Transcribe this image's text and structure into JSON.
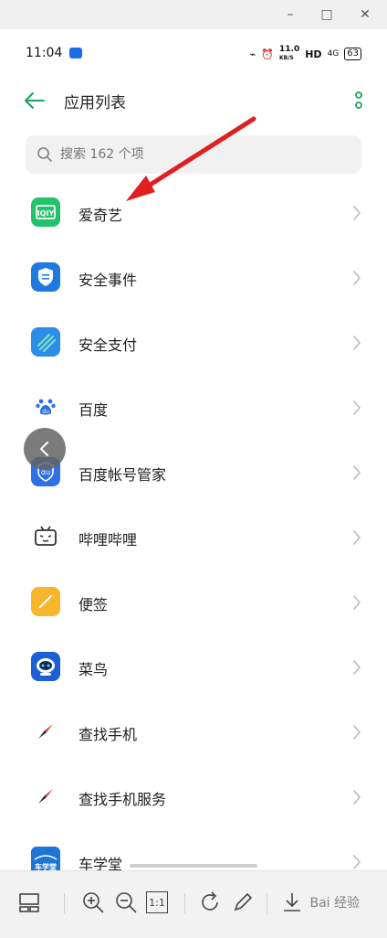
{
  "window": {
    "minimize": "–",
    "maximize": "□",
    "close": "✕"
  },
  "status": {
    "time": "11:04",
    "speed": "11.0",
    "speed_unit": "KB/S",
    "hd": "HD",
    "net": "4G",
    "battery": "63"
  },
  "header": {
    "title": "应用列表"
  },
  "search": {
    "placeholder": "搜索 162 个项"
  },
  "apps": [
    {
      "name": "爱奇艺",
      "icon": "iqiyi-icon",
      "color": "#22c36a"
    },
    {
      "name": "安全事件",
      "icon": "shield-icon",
      "color": "#1f7ae0"
    },
    {
      "name": "安全支付",
      "icon": "secure-pay-icon",
      "color": "#2b8de6"
    },
    {
      "name": "百度",
      "icon": "baidu-paw-icon",
      "color": "#2f6fe8"
    },
    {
      "name": "百度帐号管家",
      "icon": "baidu-account-icon",
      "color": "#2f6fe8"
    },
    {
      "name": "哔哩哔哩",
      "icon": "bilibili-icon",
      "color": "#333333"
    },
    {
      "name": "便签",
      "icon": "notes-icon",
      "color": "#f7b62c"
    },
    {
      "name": "菜鸟",
      "icon": "cainiao-icon",
      "color": "#1c5fd6"
    },
    {
      "name": "查找手机",
      "icon": "compass-icon",
      "color": "#e03b3b"
    },
    {
      "name": "查找手机服务",
      "icon": "compass-icon",
      "color": "#e03b3b"
    },
    {
      "name": "车学堂",
      "icon": "chexuetang-icon",
      "color": "#1d76d6"
    }
  ],
  "toolbar": {
    "ratio_label": "1:1",
    "watermark": "Bai 经验"
  },
  "colors": {
    "accent": "#1aa35a",
    "arrow": "#e02020"
  }
}
